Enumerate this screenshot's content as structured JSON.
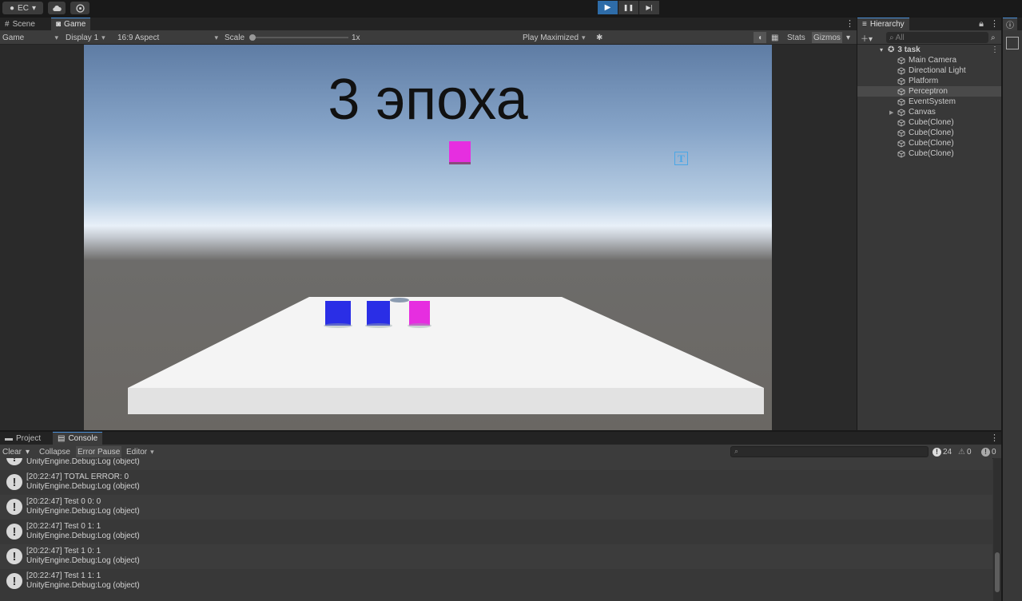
{
  "toolbar": {
    "account_label": "EC",
    "play_buttons": [
      "▶",
      "❚❚",
      "▶|"
    ]
  },
  "game_panel": {
    "tabs": [
      {
        "label": "Scene"
      },
      {
        "label": "Game"
      }
    ],
    "view_mode": "Game",
    "display": "Display 1",
    "aspect": "16:9 Aspect",
    "scale_label": "Scale",
    "scale_value": "1x",
    "scale_level": 0.0,
    "play_mode": "Play Maximized",
    "stats_label": "Stats",
    "gizmos_label": "Gizmos"
  },
  "game_view": {
    "title_text": "3 эпоха",
    "gizmo_letter": "T",
    "colors": {
      "blue_cube": "#2a2ee6",
      "magenta_cube": "#e62ee0",
      "platform": "#f2f2f2"
    }
  },
  "hierarchy": {
    "tab_label": "Hierarchy",
    "search_placeholder": "All",
    "scene_name": "3 task",
    "items": [
      {
        "label": "Main Camera",
        "selected": false
      },
      {
        "label": "Directional Light",
        "selected": false
      },
      {
        "label": "Platform",
        "selected": false
      },
      {
        "label": "Perceptron",
        "selected": true
      },
      {
        "label": "EventSystem",
        "selected": false
      },
      {
        "label": "Canvas",
        "selected": false,
        "expandable": true
      },
      {
        "label": "Cube(Clone)",
        "selected": false
      },
      {
        "label": "Cube(Clone)",
        "selected": false
      },
      {
        "label": "Cube(Clone)",
        "selected": false
      },
      {
        "label": "Cube(Clone)",
        "selected": false
      }
    ]
  },
  "console": {
    "tabs": [
      {
        "label": "Project"
      },
      {
        "label": "Console"
      }
    ],
    "clear_label": "Clear",
    "collapse_label": "Collapse",
    "error_pause_label": "Error Pause",
    "editor_label": "Editor",
    "counts": {
      "info": "24",
      "warn": "0",
      "error": "0"
    },
    "logs": [
      {
        "line1": "[20:22:47] TOTAL ERROR: 0",
        "line2": "UnityEngine.Debug:Log (object)"
      },
      {
        "line1": "[20:22:47] Test 0 0: 0",
        "line2": "UnityEngine.Debug:Log (object)"
      },
      {
        "line1": "[20:22:47] Test 0 1: 1",
        "line2": "UnityEngine.Debug:Log (object)"
      },
      {
        "line1": "[20:22:47] Test 1 0: 1",
        "line2": "UnityEngine.Debug:Log (object)"
      },
      {
        "line1": "[20:22:47] Test 1 1: 1",
        "line2": "UnityEngine.Debug:Log (object)"
      }
    ],
    "partial_log_line2": "UnityEngine.Debug:Log (object)"
  }
}
